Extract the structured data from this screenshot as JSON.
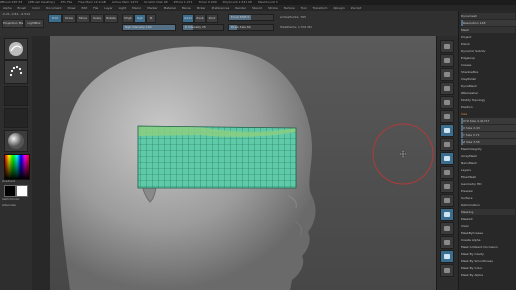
{
  "window": {
    "title_parts": [
      "ZBrush 4R7 P3",
      "[ZBrush Desktop]",
      "ZTL File",
      "Free Mem 12.9 GB",
      "Active Mem 1473",
      "Scratch Disk 48",
      "ZTime 1.471",
      "Timer 0.009",
      "PolyCount 1.531 KP",
      "MeshCount 3"
    ],
    "menus": [
      "Alpha",
      "Brush",
      "Color",
      "Document",
      "Draw",
      "Edit",
      "File",
      "Layer",
      "Light",
      "Macro",
      "Marker",
      "Material",
      "Movie",
      "Picker",
      "Preferences",
      "Render",
      "Stencil",
      "Stroke",
      "Texture",
      "Tool",
      "Transform",
      "Zplugin",
      "Zscript"
    ]
  },
  "toolbar": {
    "coords": "-0.21, 0.81, -0.514",
    "projection_master": "Projection Master",
    "lightbox": "LightBox",
    "edit": "Edit",
    "draw": "Draw",
    "move": "Move",
    "scale": "Scale",
    "rotate": "Rotate",
    "mrgb": "Mrgb",
    "rgb": "Rgb",
    "m": "M",
    "zadd": "Zadd",
    "zsub": "Zsub",
    "zcut": "Zcut",
    "focal_shift": "Focal Shift 0",
    "draw_size": "Draw Size 64",
    "rgb_intensity": "Rgb Intensity 100",
    "z_intensity": "Z Intensity 25",
    "active_points": "ActivePoints: 765",
    "total_points": "TotalPoints: 1.531 Mil"
  },
  "levels": {
    "draw_size_fraction": 0.18,
    "rgb_intensity_fraction": 1.0,
    "z_intensity_fraction": 0.25,
    "focal_shift_fraction": 0.5
  },
  "leftshelf": {
    "gradient_label": "Gradient",
    "switch_color_label": "SwitchColor",
    "alternate_label": "Alternate"
  },
  "trays": {
    "rows": [
      {
        "label": "Dynamesh",
        "kind": "hdr"
      },
      {
        "label": "Resolution 128",
        "kind": "slider"
      },
      {
        "label": "Mesh",
        "kind": "hdr"
      },
      {
        "label": "Project",
        "kind": "plain"
      },
      {
        "label": "Polish",
        "kind": "plain"
      },
      {
        "label": "Dynamic Subdiv",
        "kind": "plain"
      },
      {
        "label": "Edgeloop",
        "kind": "plain"
      },
      {
        "label": "Crease",
        "kind": "plain"
      },
      {
        "label": "ShadowBox",
        "kind": "plain"
      },
      {
        "label": "ClayPolish",
        "kind": "plain"
      },
      {
        "label": "DynaMesh",
        "kind": "plain"
      },
      {
        "label": "ZRemesher",
        "kind": "plain"
      },
      {
        "label": "Modify Topology",
        "kind": "plain"
      },
      {
        "label": "Position",
        "kind": "plain"
      },
      {
        "label": "Size",
        "kind": "orange"
      },
      {
        "label": "XYZ Size 4.41717",
        "kind": "slider"
      },
      {
        "label": "X Size 2.43",
        "kind": "slider"
      },
      {
        "label": "Y Size 3.71",
        "kind": "slider"
      },
      {
        "label": "Z Size 3.55",
        "kind": "slider"
      },
      {
        "label": "MeshIntegrity",
        "kind": "plain"
      },
      {
        "label": "ArrayMesh",
        "kind": "plain"
      },
      {
        "label": "NanoMesh",
        "kind": "plain"
      },
      {
        "label": "Layers",
        "kind": "plain"
      },
      {
        "label": "FiberMesh",
        "kind": "plain"
      },
      {
        "label": "Geometry HD",
        "kind": "plain"
      },
      {
        "label": "Preview",
        "kind": "plain"
      },
      {
        "label": "Surface",
        "kind": "plain"
      },
      {
        "label": "Deformation",
        "kind": "plain"
      },
      {
        "label": "Masking",
        "kind": "hdr"
      },
      {
        "label": "MaskAll",
        "kind": "plain"
      },
      {
        "label": "Clear",
        "kind": "plain"
      },
      {
        "label": "MaskByCrease",
        "kind": "plain"
      },
      {
        "label": "Create Alpha",
        "kind": "plain"
      },
      {
        "label": "Mask Ambient Occlusion",
        "kind": "plain"
      },
      {
        "label": "Mask By Cavity",
        "kind": "plain"
      },
      {
        "label": "Mask By Smoothness",
        "kind": "plain"
      },
      {
        "label": "Mask By Color",
        "kind": "plain"
      },
      {
        "label": "Mask By Alpha",
        "kind": "plain"
      }
    ]
  },
  "colors": {
    "accent": "#3b6d8e",
    "band_fill": "#5fcaa8",
    "band_grid": "#1d6e52",
    "cursor_ring": "#b03a3a",
    "orange": "#e08a30"
  }
}
